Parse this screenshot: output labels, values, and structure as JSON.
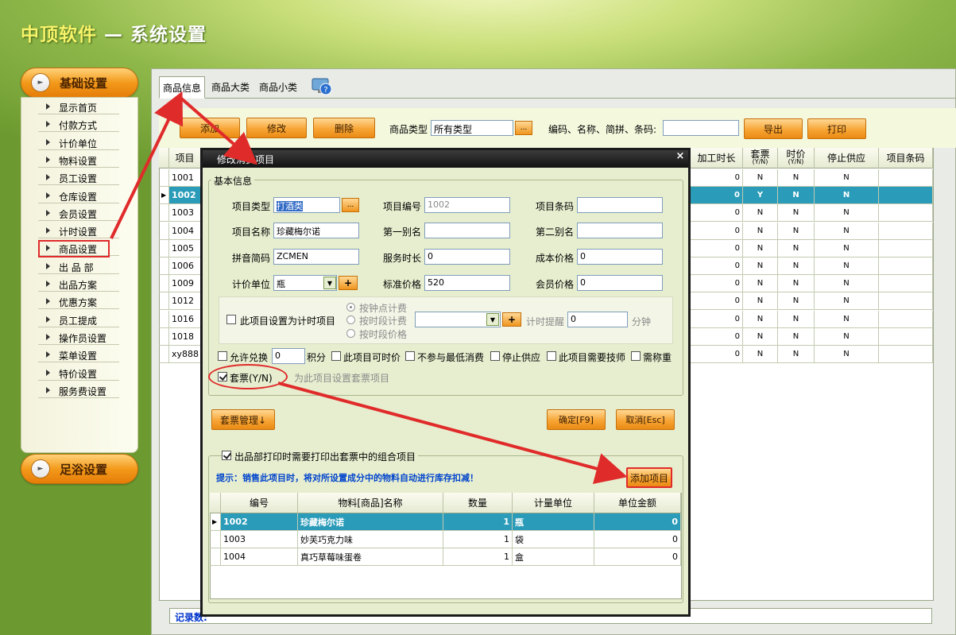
{
  "app": {
    "brand": "中顶软件",
    "title_rest": " — 系统设置"
  },
  "sidebar": {
    "group1": "基础设置",
    "items": [
      "显示首页",
      "付款方式",
      "计价单位",
      "物料设置",
      "员工设置",
      "仓库设置",
      "会员设置",
      "计时设置",
      "商品设置",
      "出 品 部",
      "出品方案",
      "优惠方案",
      "员工提成",
      "操作员设置",
      "菜单设置",
      "特价设置",
      "服务费设置"
    ],
    "group2": "足浴设置"
  },
  "tabs": [
    "商品信息",
    "商品大类",
    "商品小类"
  ],
  "toolbar": {
    "add": "添加",
    "edit": "修改",
    "delete": "删除",
    "category_label": "商品类型",
    "category_value": "所有类型",
    "browse": "...",
    "search_label": "编码、名称、简拼、条码:",
    "search_value": "",
    "export": "导出",
    "print": "打印"
  },
  "grid": {
    "headers": {
      "item": "项目",
      "process_time": "加工时长",
      "ticket": "套票",
      "ticket_sub": "(Y/N)",
      "timed": "时价",
      "timed_sub": "(Y/N)",
      "stop": "停止供应",
      "barcode": "项目条码"
    },
    "rows": [
      {
        "code": "1001",
        "pt": "0",
        "tk": "N",
        "tm": "N",
        "st": "N"
      },
      {
        "code": "1002",
        "pt": "0",
        "tk": "Y",
        "tm": "N",
        "st": "N"
      },
      {
        "code": "1003",
        "pt": "0",
        "tk": "N",
        "tm": "N",
        "st": "N"
      },
      {
        "code": "1004",
        "pt": "0",
        "tk": "N",
        "tm": "N",
        "st": "N"
      },
      {
        "code": "1005",
        "pt": "0",
        "tk": "N",
        "tm": "N",
        "st": "N"
      },
      {
        "code": "1006",
        "pt": "0",
        "tk": "N",
        "tm": "N",
        "st": "N"
      },
      {
        "code": "1009",
        "pt": "0",
        "tk": "N",
        "tm": "N",
        "st": "N"
      },
      {
        "code": "1012",
        "pt": "0",
        "tk": "N",
        "tm": "N",
        "st": "N"
      },
      {
        "code": "1016",
        "pt": "0",
        "tk": "N",
        "tm": "N",
        "st": "N"
      },
      {
        "code": "1018",
        "pt": "0",
        "tk": "N",
        "tm": "N",
        "st": "N"
      },
      {
        "code": "xy888",
        "pt": "0",
        "tk": "N",
        "tm": "N",
        "st": "N"
      }
    ],
    "selected_index": 1
  },
  "status": {
    "records": "记录数:"
  },
  "dialog": {
    "title": "修改消费项目",
    "close": "×",
    "basic_group": "基本信息",
    "item_type_label": "项目类型",
    "item_type_value": "打酒类",
    "item_code_label": "项目编号",
    "item_code_value": "1002",
    "barcode_label": "项目条码",
    "barcode_value": "",
    "name_label": "项目名称",
    "name_value": "珍藏梅尔诺",
    "alias1_label": "第一别名",
    "alias1_value": "",
    "alias2_label": "第二别名",
    "alias2_value": "",
    "pinyin_label": "拼音简码",
    "pinyin_value": "ZCMEN",
    "service_label": "服务时长",
    "service_value": "0",
    "cost_label": "成本价格",
    "cost_value": "0",
    "unit_label": "计价单位",
    "unit_value": "瓶",
    "price_label": "标准价格",
    "price_value": "520",
    "member_label": "会员价格",
    "member_value": "0",
    "timed_check": "此项目设置为计时项目",
    "radio1": "按钟点计费",
    "radio2": "按时段计费",
    "radio3": "按时段价格",
    "remind_label": "计时提醒",
    "remind_value": "0",
    "minute": "分钟",
    "allow_exchange": "允许兑换",
    "exchange_value": "0",
    "points": "积分",
    "opt_timeprice": "此项目可时价",
    "opt_nomin": "不参与最低消费",
    "opt_stop": "停止供应",
    "opt_tech": "此项目需要技师",
    "opt_weigh": "需称重",
    "ticket_check": "套票(Y/N)",
    "ticket_hint": "为此项目设置套票项目",
    "ticket_manage": "套票管理↓",
    "ok": "确定[F9]",
    "cancel": "取消[Esc]",
    "combo_group": "出品部打印时需要打印出套票中的组合项目",
    "tip": "提示：销售此项目时，将对所设置成分中的物料自动进行库存扣减！",
    "add_item": "添加项目",
    "sub_headers": [
      "编号",
      "物料[商品]名称",
      "数量",
      "计量单位",
      "单位金额"
    ],
    "sub_rows": [
      {
        "code": "1002",
        "name": "珍藏梅尔诺",
        "qty": "1",
        "unit": "瓶",
        "amt": "0"
      },
      {
        "code": "1003",
        "name": "妙芙巧克力味",
        "qty": "1",
        "unit": "袋",
        "amt": "0"
      },
      {
        "code": "1004",
        "name": "真巧草莓味蛋卷",
        "qty": "1",
        "unit": "盒",
        "amt": "0"
      }
    ]
  },
  "colors": {
    "accent_orange": "#f7a535",
    "selected_row": "#2a9bb8",
    "annotation_red": "#e02b2b"
  }
}
